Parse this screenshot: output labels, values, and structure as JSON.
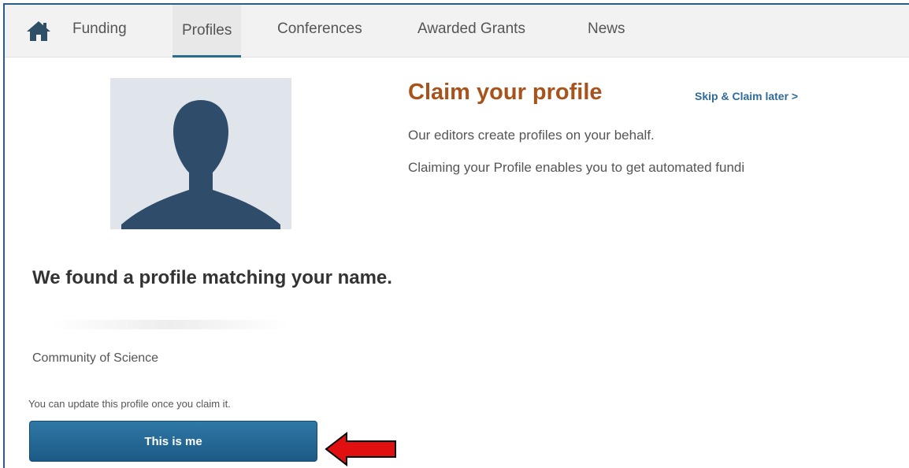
{
  "nav": {
    "items": [
      {
        "label": "Funding"
      },
      {
        "label": "Profiles",
        "active": true
      },
      {
        "label": "Conferences"
      },
      {
        "label": "Awarded Grants"
      },
      {
        "label": "News"
      }
    ]
  },
  "claim": {
    "title": "Claim your profile",
    "skip_label": "Skip & Claim later >",
    "line1": "Our editors create profiles on your behalf.",
    "line2": "Claiming your Profile enables you to get automated fundi"
  },
  "match": {
    "heading": "We found a profile matching your name.",
    "organization": "Community of Science",
    "update_note": "You can update this profile once you claim it.",
    "button_label": "This is me"
  },
  "colors": {
    "title": "#a8531c",
    "link": "#2f6b9a",
    "button": "#1f6494",
    "annotation_arrow": "#e01010"
  }
}
